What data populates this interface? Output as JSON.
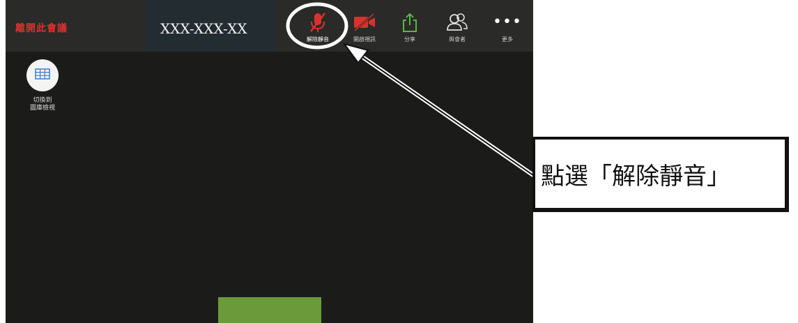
{
  "toolbar": {
    "leave_label": "離開此會議",
    "meeting_id": "XXX-XXX-XX",
    "unmute_label": "解除靜音",
    "video_label": "開啟視訊",
    "share_label": "分享",
    "participants_label": "與會者",
    "more_label": "更多",
    "more_glyph": "•••"
  },
  "gallery": {
    "label_line1": "切換到",
    "label_line2": "圖庫檢視"
  },
  "annotation": {
    "callout_text": "點選「解除靜音」",
    "highlight_color": "#ffffff"
  },
  "colors": {
    "leave_red": "#d8322e",
    "mic_red": "#d8322e",
    "share_green": "#5ab84a",
    "toolbar_bg": "#2a2a28",
    "meeting_bg": "#1b1c1a",
    "video_tile": "#6a9a3a"
  },
  "icons": {
    "unmute": "muted-microphone-icon",
    "video": "video-off-icon",
    "share": "share-upload-icon",
    "participants": "participants-icon",
    "more": "more-dots-icon",
    "gallery": "gallery-grid-icon"
  }
}
